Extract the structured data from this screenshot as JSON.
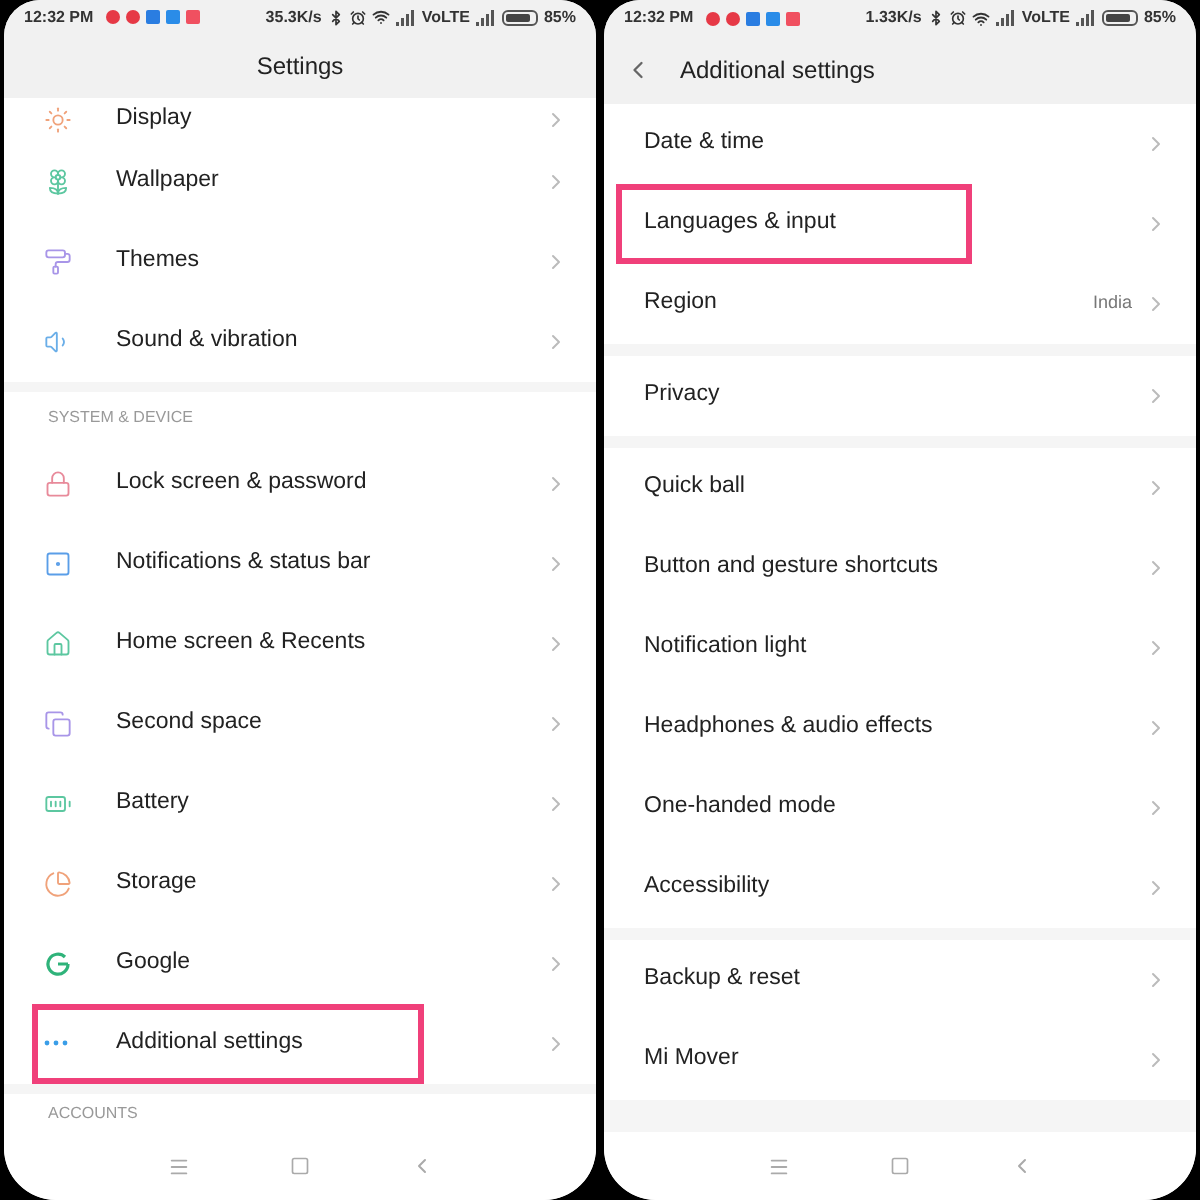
{
  "screens": [
    {
      "kind": "main",
      "status_bar": {
        "time": "12:32 PM",
        "speed": "35.3K/s",
        "network": "VoLTE",
        "battery": "85%"
      },
      "header": {
        "title": "Settings",
        "back": false
      },
      "sections": [
        {
          "items": [
            {
              "label": "Display",
              "highlighted": false
            },
            {
              "label": "Wallpaper",
              "highlighted": false
            },
            {
              "label": "Themes",
              "highlighted": false
            },
            {
              "label": "Sound & vibration",
              "highlighted": false
            }
          ]
        },
        {
          "heading": "SYSTEM & DEVICE",
          "items": [
            {
              "label": "Lock screen & password",
              "highlighted": false
            },
            {
              "label": "Notifications & status bar",
              "highlighted": false
            },
            {
              "label": "Home screen & Recents",
              "highlighted": false
            },
            {
              "label": "Second space",
              "highlighted": false
            },
            {
              "label": "Battery",
              "highlighted": false
            },
            {
              "label": "Storage",
              "highlighted": false
            },
            {
              "label": "Google",
              "highlighted": false
            },
            {
              "label": "Additional settings",
              "highlighted": true
            }
          ]
        },
        {
          "heading": "ACCOUNTS"
        }
      ]
    },
    {
      "kind": "sub",
      "status_bar": {
        "time": "12:32 PM",
        "speed": "1.33K/s",
        "network": "VoLTE",
        "battery": "85%"
      },
      "header": {
        "title": "Additional settings",
        "back": true
      },
      "sections": [
        {
          "items": [
            {
              "label": "Date & time",
              "highlighted": false
            },
            {
              "label": "Languages & input",
              "highlighted": true
            },
            {
              "label": "Region",
              "value": "India",
              "highlighted": false
            }
          ]
        },
        {
          "items": [
            {
              "label": "Privacy",
              "highlighted": false
            }
          ]
        },
        {
          "items": [
            {
              "label": "Quick ball",
              "highlighted": false
            },
            {
              "label": "Button and gesture shortcuts",
              "highlighted": false
            },
            {
              "label": "Notification light",
              "highlighted": false
            },
            {
              "label": "Headphones & audio effects",
              "highlighted": false
            },
            {
              "label": "One-handed mode",
              "highlighted": false
            },
            {
              "label": "Accessibility",
              "highlighted": false
            }
          ]
        },
        {
          "items": [
            {
              "label": "Backup & reset",
              "highlighted": false
            },
            {
              "label": "Mi Mover",
              "highlighted": false
            }
          ]
        }
      ]
    }
  ]
}
